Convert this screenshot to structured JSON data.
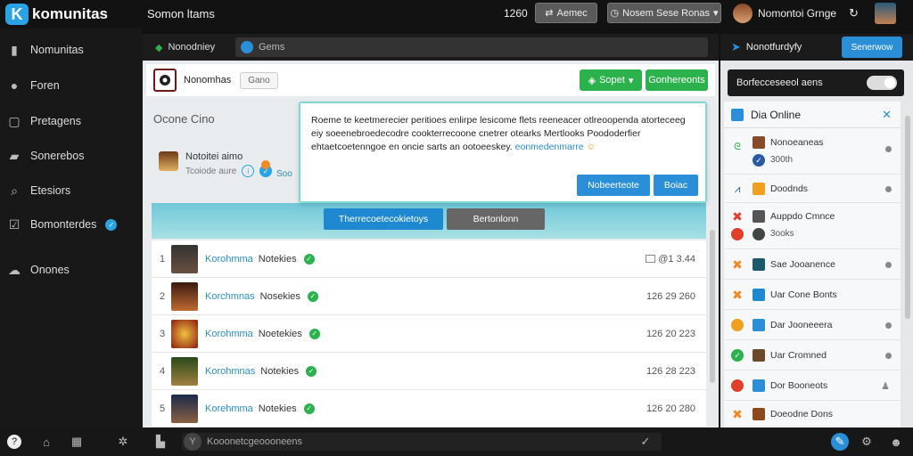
{
  "app": {
    "name": "komunitas",
    "logo_letter": "K"
  },
  "topbar": {
    "title": "Somon ltams",
    "count": "1260",
    "btn1": "Aemec",
    "btn2": "Nosem Sese Ronas",
    "user": "Nomontoi Grnge"
  },
  "sidebar": {
    "items": [
      {
        "label": "Nomunitas",
        "icon": "doc-icon"
      },
      {
        "label": "Foren",
        "icon": "circle-icon"
      },
      {
        "label": "Pretagens",
        "icon": "square-icon"
      },
      {
        "label": "Sonerebos",
        "icon": "folder-icon"
      },
      {
        "label": "Etesiors",
        "icon": "search-icon"
      },
      {
        "label": "Bomonterdes",
        "icon": "checkbox-icon",
        "badge": "✓"
      },
      {
        "label": "Onones",
        "icon": "cloud-icon"
      }
    ]
  },
  "subheader": {
    "left": "Nonodniey",
    "search": "Gems"
  },
  "group": {
    "name": "Nonomhas",
    "tag": "Gano",
    "btn_primary": "Sopet",
    "btn_secondary": "Gonhereonts"
  },
  "section_label": "Ocone Cino",
  "host": {
    "name": "Notoitei aimo",
    "sub": "Tcoiode aure",
    "score": "Soo"
  },
  "popup": {
    "text": "Roeme te keetmerecier peritioes enlirpe lesicome flets reeneacer otlreoopenda atorteceeg eiy soeenebroedecodre cookterrecoone cnetrer otearks Mertlooks Poododerfier ehtaetcoetenngoe en oncie sarts an ootoeeskey. ",
    "link": "eonmedenmarre",
    "btn1": "Nobeerteote",
    "btn2": "Boiac"
  },
  "banner": {
    "btn_primary": "Therrecoetecokietoys",
    "btn_secondary": "Bertonlonn"
  },
  "members": [
    {
      "rank": "1",
      "name": "Korohmma",
      "tag": "Notekies",
      "stat": "@1 3.44"
    },
    {
      "rank": "2",
      "name": "Korchmnas",
      "tag": "Nosekies",
      "stat": "126 29 260"
    },
    {
      "rank": "3",
      "name": "Korohmma",
      "tag": "Noetekies",
      "stat": "126 20 223"
    },
    {
      "rank": "4",
      "name": "Korohmnas",
      "tag": "Notekies",
      "stat": "126 28 223"
    },
    {
      "rank": "5",
      "name": "Korehmma",
      "tag": "Notekies",
      "stat": "126 20 280"
    }
  ],
  "right": {
    "title": "Nonotfurdyfy",
    "btn": "Senerwow",
    "bar": "Borfecceseeol aens",
    "online_title": "Dia Online",
    "friends": [
      {
        "name": "Nonoeaneas",
        "sub": "300th",
        "color": "#2bb24c"
      },
      {
        "name": "Doodnds",
        "sub": "",
        "color": "#f0a020"
      },
      {
        "name": "Auppdo Cmnce",
        "sub": "3ooks",
        "color": "#e0402a"
      },
      {
        "name": "Sae Jooanence",
        "sub": "",
        "color": "#f08a24"
      },
      {
        "name": "Uar Cone Bonts",
        "sub": "",
        "color": "#f08a24"
      },
      {
        "name": "Dar Jooneeera",
        "sub": "",
        "color": "#f0a020"
      },
      {
        "name": "Uar Cromned",
        "sub": "",
        "color": "#2bb24c"
      },
      {
        "name": "Dor Booneots",
        "sub": "",
        "color": "#e0402a"
      },
      {
        "name": "Doeodne Dons",
        "sub": "",
        "color": "#f08a24"
      }
    ]
  },
  "chat": {
    "placeholder": "Kooonetcgeoooneens"
  },
  "colors": {
    "accent": "#2a8fd6",
    "green": "#2bb24c",
    "dark": "#121212"
  }
}
